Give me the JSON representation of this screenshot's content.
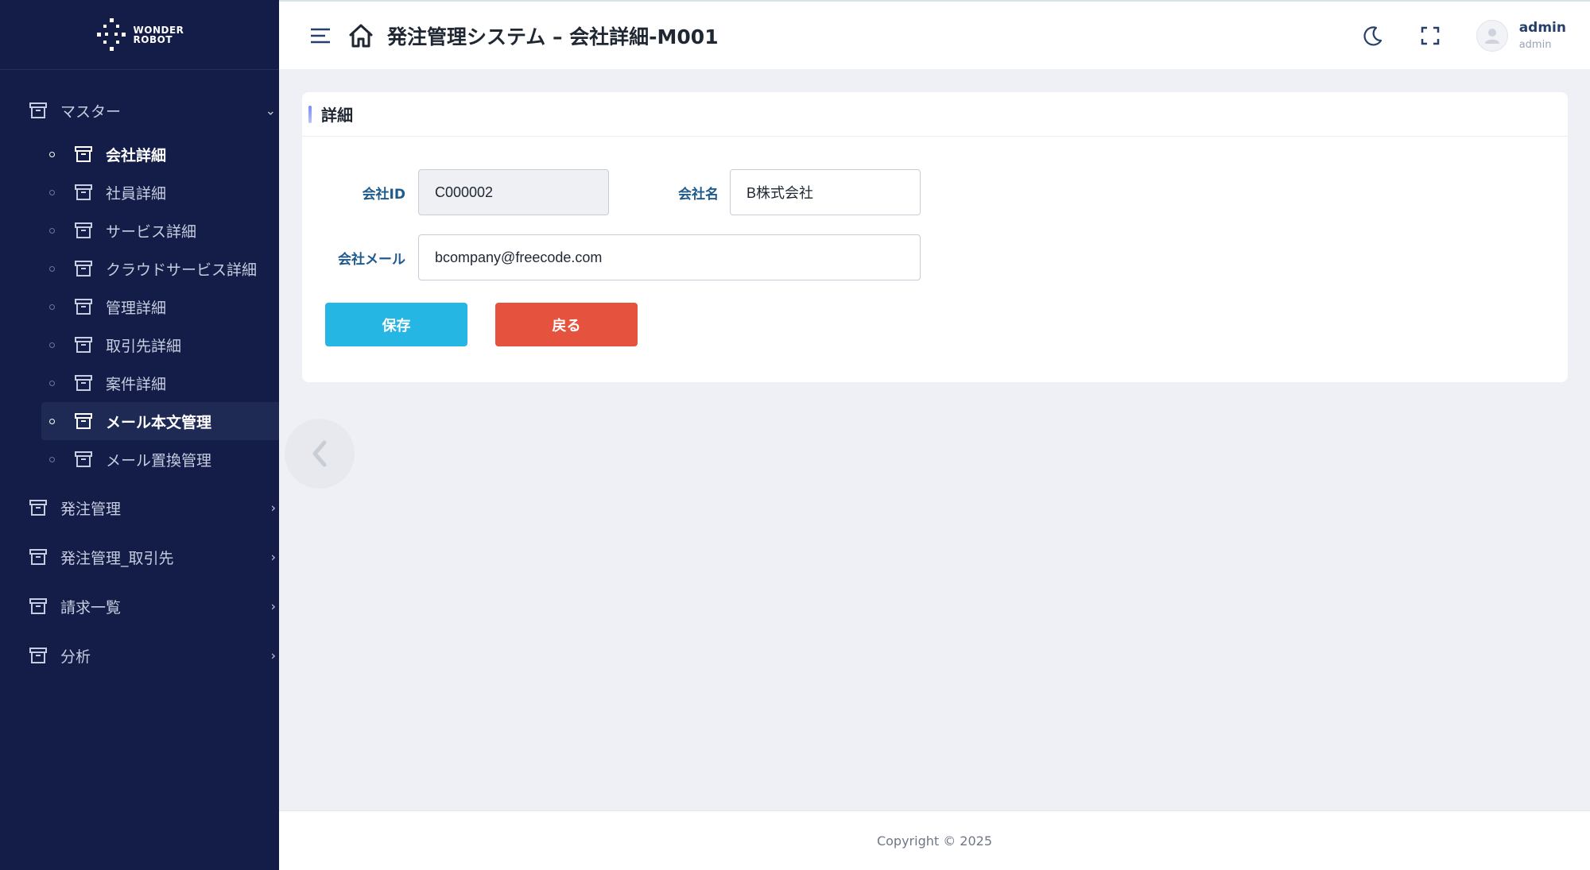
{
  "brand": {
    "line1": "WONDER",
    "line2": "ROBOT"
  },
  "header": {
    "title": "発注管理システム – 会社詳細-M001",
    "user_name": "admin",
    "user_role": "admin"
  },
  "sidebar": {
    "groups": [
      {
        "label": "マスター",
        "expanded": true,
        "items": [
          {
            "label": "会社詳細",
            "active": true
          },
          {
            "label": "社員詳細"
          },
          {
            "label": "サービス詳細"
          },
          {
            "label": "クラウドサービス詳細"
          },
          {
            "label": "管理詳細"
          },
          {
            "label": "取引先詳細"
          },
          {
            "label": "案件詳細"
          },
          {
            "label": "メール本文管理",
            "active": true,
            "highlighted": true
          },
          {
            "label": "メール置換管理"
          }
        ]
      },
      {
        "label": "発注管理"
      },
      {
        "label": "発注管理_取引先"
      },
      {
        "label": "請求一覧"
      },
      {
        "label": "分析"
      }
    ]
  },
  "card": {
    "title": "詳細",
    "fields": {
      "company_id": {
        "label": "会社ID",
        "value": "C000002"
      },
      "company_name": {
        "label": "会社名",
        "value": "B株式会社"
      },
      "company_mail": {
        "label": "会社メール",
        "value": "bcompany@freecode.com"
      }
    },
    "save_label": "保存",
    "back_label": "戻る"
  },
  "footer": {
    "copyright": "Copyright © 2025"
  },
  "colors": {
    "sidebar_bg": "#131d47",
    "save_button": "#25b6e4",
    "back_button": "#e5533e",
    "label_blue": "#1f5b8d"
  },
  "icons": [
    "logo-icon",
    "archive-icon",
    "menu-icon",
    "home-icon",
    "moon-icon",
    "fullscreen-icon",
    "user-icon",
    "chevron-left-icon"
  ]
}
